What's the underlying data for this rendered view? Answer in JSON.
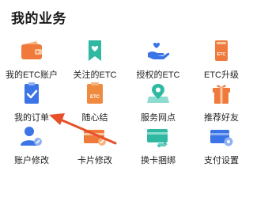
{
  "section": {
    "title": "我的业务"
  },
  "items": [
    {
      "label": "我的ETC账户",
      "icon": "wallet-icon",
      "color": "#ef7a3c"
    },
    {
      "label": "关注的ETC",
      "icon": "heart-bookmark-icon",
      "color": "#2fb9a3"
    },
    {
      "label": "授权的ETC",
      "icon": "hand-heart-icon",
      "color": "#3b74e6"
    },
    {
      "label": "ETC升级",
      "icon": "etc-card-upgrade-icon",
      "color": "#ef7a3c"
    },
    {
      "label": "我的订单",
      "icon": "clipboard-check-icon",
      "color": "#3b74e6"
    },
    {
      "label": "随心结",
      "icon": "etc-card-icon",
      "color": "#f08a3f"
    },
    {
      "label": "服务网点",
      "icon": "map-pin-icon",
      "color": "#2fb9a3"
    },
    {
      "label": "推荐好友",
      "icon": "gift-icon",
      "color": "#ef7a3c"
    },
    {
      "label": "账户修改",
      "icon": "user-edit-icon",
      "color": "#3b74e6"
    },
    {
      "label": "卡片修改",
      "icon": "card-edit-icon",
      "color": "#ef7a3c"
    },
    {
      "label": "换卡捆绑",
      "icon": "card-exchange-icon",
      "color": "#2fb9a3"
    },
    {
      "label": "支付设置",
      "icon": "card-settings-icon",
      "color": "#3b74e6"
    }
  ],
  "icon_text": {
    "etc": "ETC"
  },
  "annotation": {
    "arrow_color": "#e8502a"
  }
}
